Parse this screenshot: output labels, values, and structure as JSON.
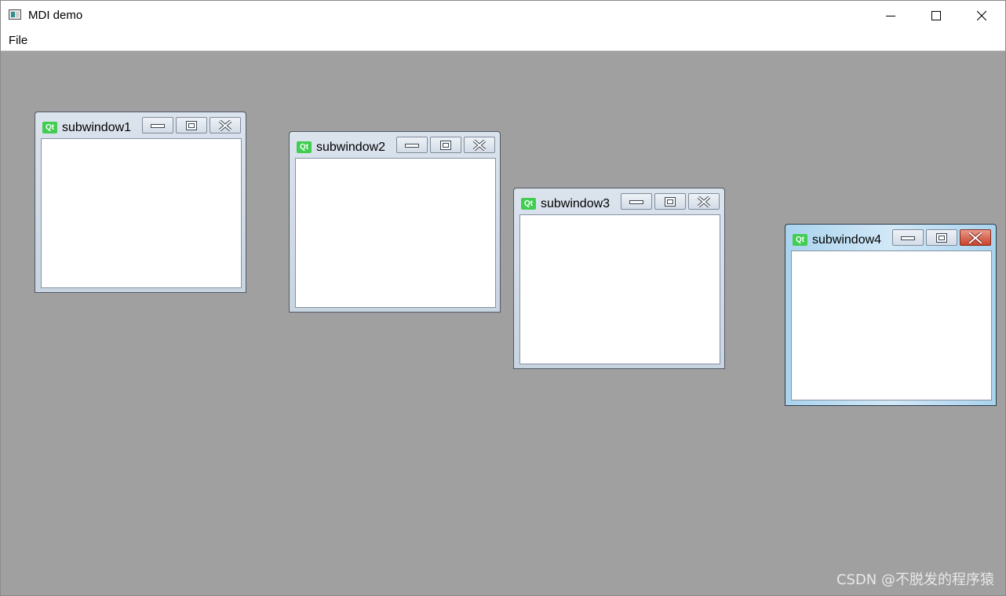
{
  "window": {
    "title": "MDI demo",
    "icon": "app-window-icon",
    "controls": {
      "minimize": "minimize-icon",
      "maximize": "maximize-icon",
      "close": "close-icon"
    }
  },
  "menubar": {
    "items": [
      {
        "label": "File"
      }
    ]
  },
  "mdi": {
    "background": "#a0a0a0",
    "subwindows": [
      {
        "title": "subwindow1",
        "icon_label": "Qt",
        "active": false
      },
      {
        "title": "subwindow2",
        "icon_label": "Qt",
        "active": false
      },
      {
        "title": "subwindow3",
        "icon_label": "Qt",
        "active": false
      },
      {
        "title": "subwindow4",
        "icon_label": "Qt",
        "active": true
      }
    ]
  },
  "watermark": "CSDN @不脱发的程序猿"
}
